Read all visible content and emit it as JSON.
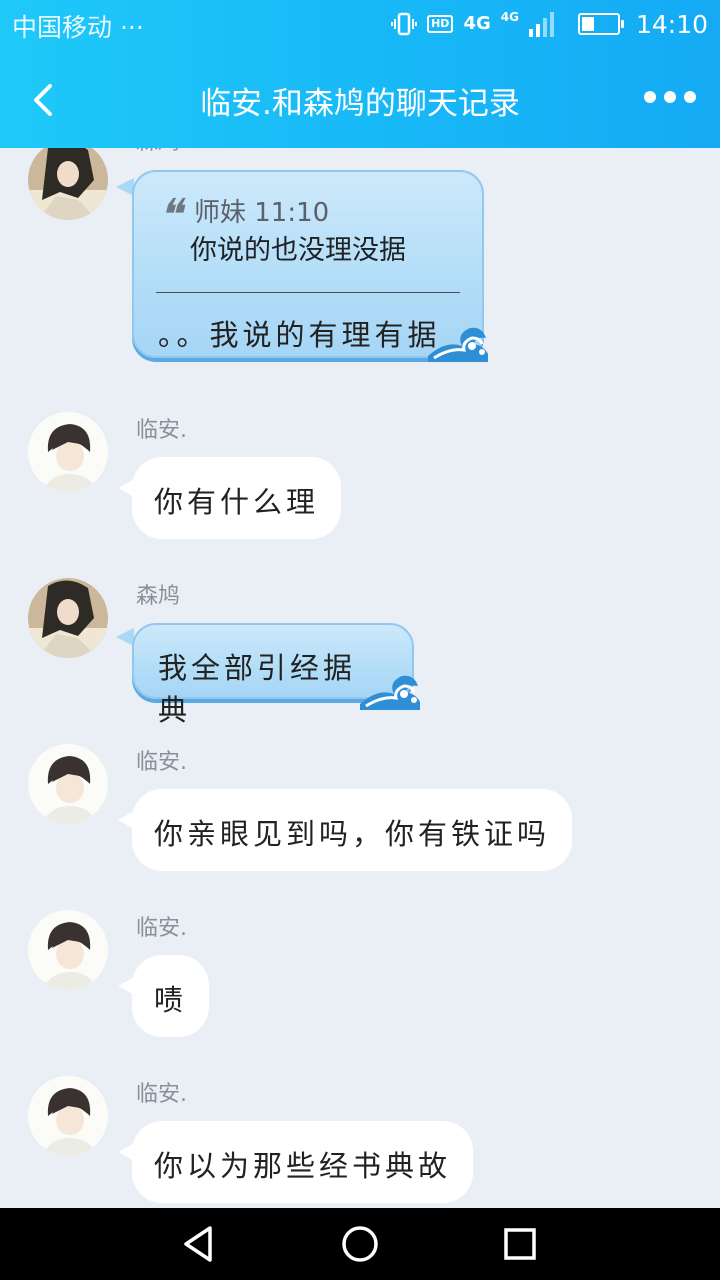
{
  "status_bar": {
    "carrier": "中国移动",
    "carrier_extra": "···",
    "hd": "HD",
    "network": "4G",
    "network2": "4G",
    "time": "14:10",
    "battery_level": 0.35
  },
  "header": {
    "title": "临安.和森鸠的聊天记录",
    "back_icon": "back-arrow-icon",
    "more_icon": "more-dots-icon"
  },
  "messages": [
    {
      "sender": "森鸠",
      "quote_meta": "师妹 11:10",
      "quote_text": "你说的也没理没据",
      "text": "。。我说的有理有据"
    },
    {
      "sender": "临安.",
      "text": "你有什么理"
    },
    {
      "sender": "森鸠",
      "text": "我全部引经据典"
    },
    {
      "sender": "临安.",
      "text": "你亲眼见到吗，你有铁证吗"
    },
    {
      "sender": "临安.",
      "text": "啧"
    },
    {
      "sender": "临安.",
      "text": "你以为那些经书典故"
    }
  ],
  "nav": {
    "back": "nav-back-icon",
    "home": "nav-home-icon",
    "recents": "nav-recents-icon"
  },
  "colors": {
    "accent": "#18b8f7",
    "chat_bg": "#eaeef5",
    "blue_bubble": "#b2ddf7"
  }
}
